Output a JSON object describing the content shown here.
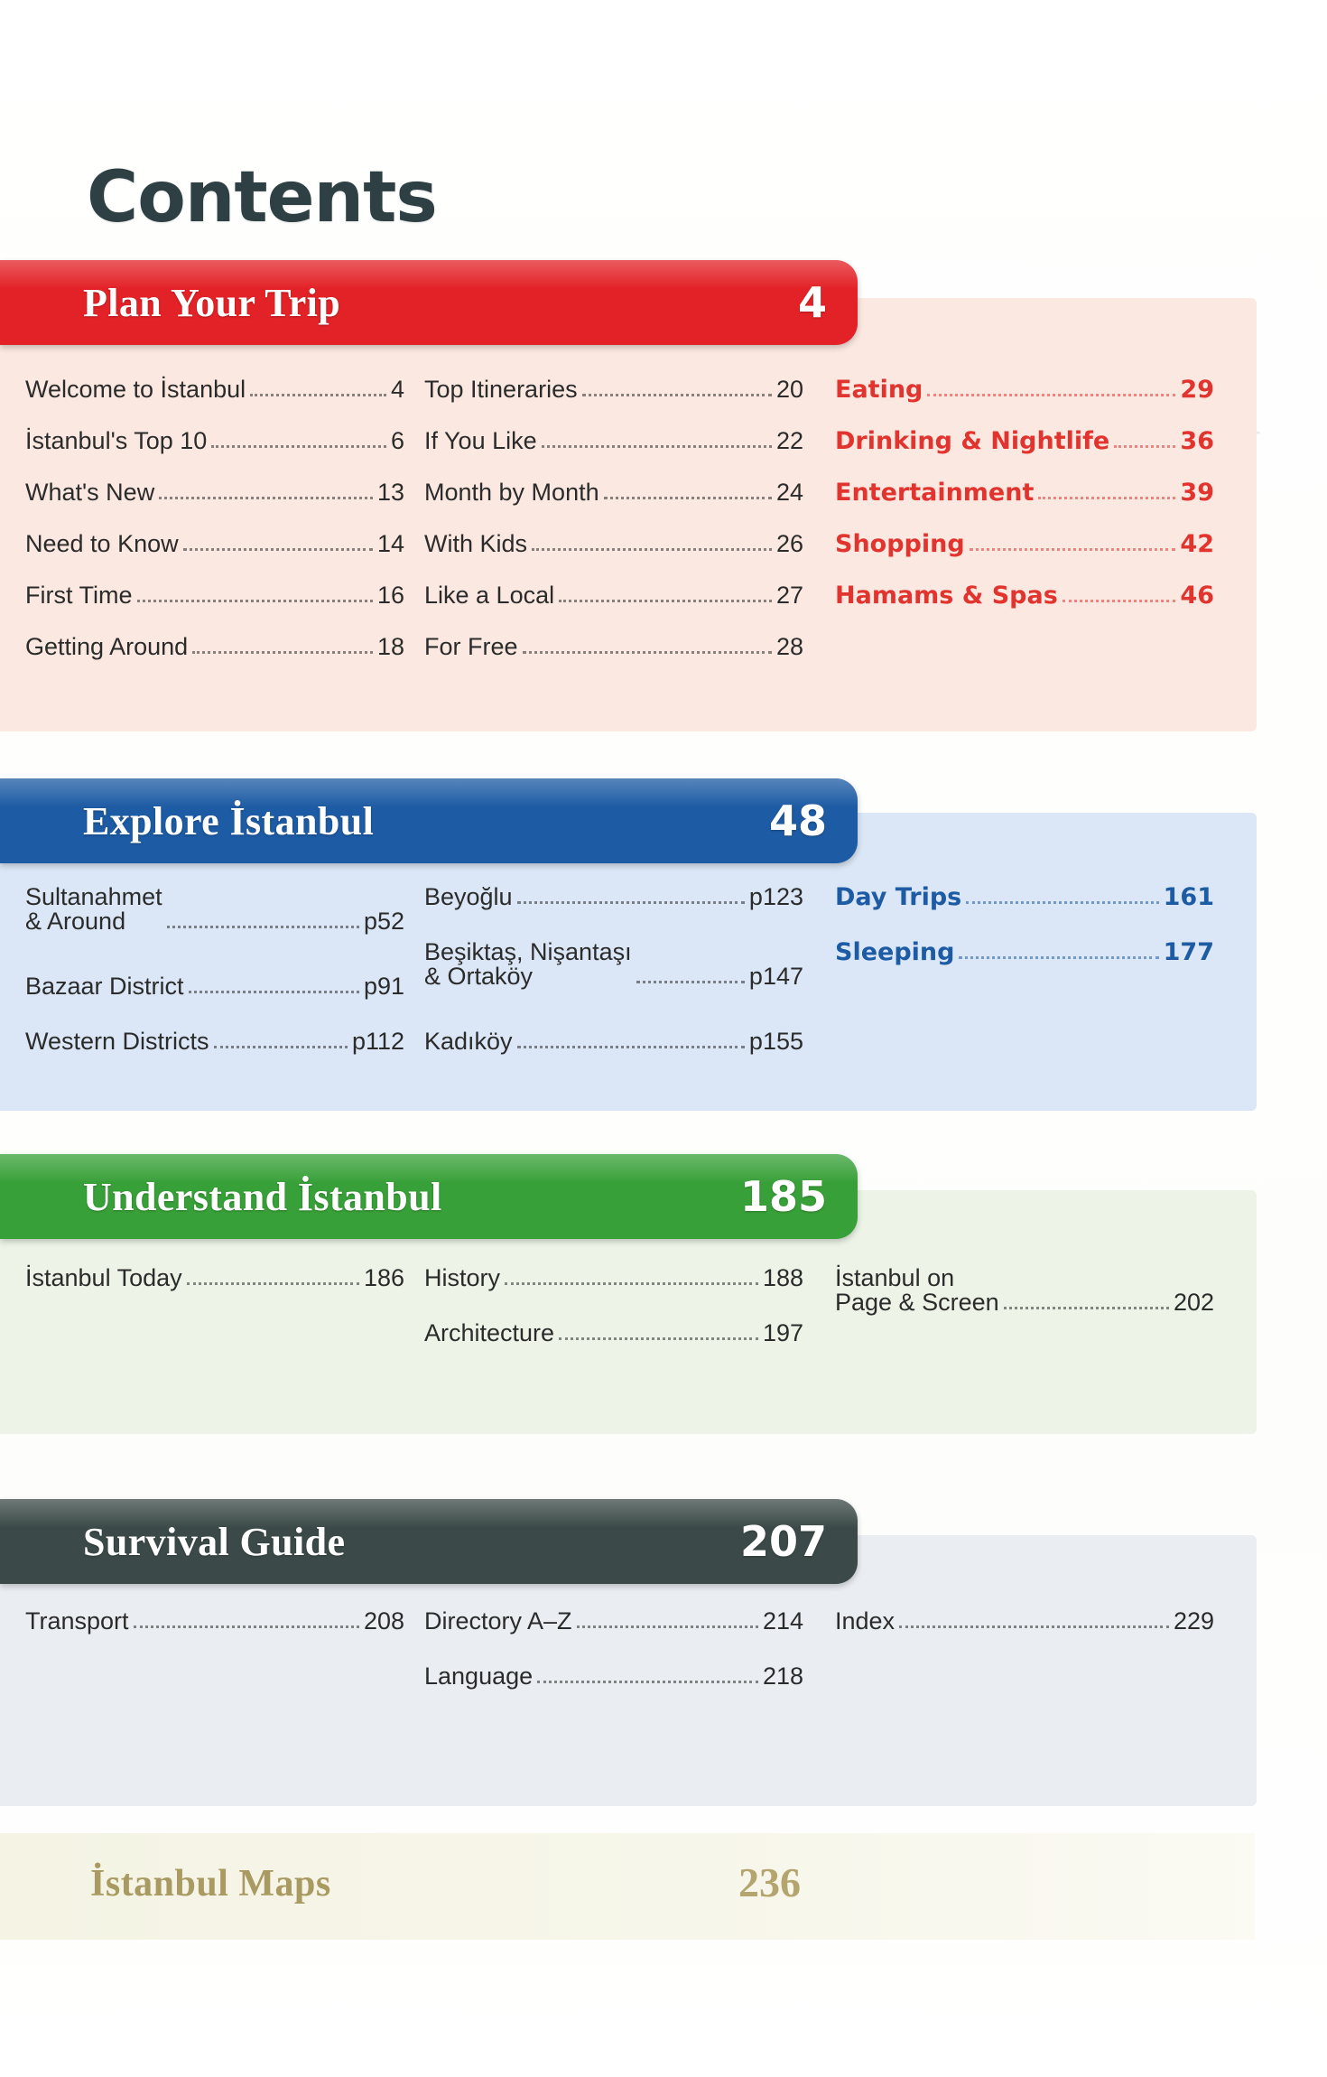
{
  "page": {
    "heading": "Contents"
  },
  "colors": {
    "plan_bar": "#e32227",
    "plan_panel": "#fbe9e1",
    "plan_accent": "#e2342f",
    "explore_bar": "#1d5ba4",
    "explore_panel": "#dbe7f6",
    "explore_accent": "#1d5ba4",
    "understand_bar": "#38a038",
    "understand_panel": "#edf4e7",
    "understand_accent": "#3c3c3c",
    "survival_bar": "#3b4a48",
    "survival_panel": "#eaeef3",
    "survival_accent": "#3c3c3c",
    "maps_strip": "#f5f4e6",
    "maps_text": "#a99a62",
    "body_text": "#2b2b2b"
  },
  "sections": [
    {
      "id": "plan-your-trip",
      "title": "Plan Your Trip",
      "page": "4",
      "columns": [
        {
          "accent": false,
          "entries": [
            {
              "label": "Welcome to İstanbul",
              "page": "4"
            },
            {
              "label": "İstanbul's Top 10",
              "page": "6"
            },
            {
              "label": "What's New",
              "page": "13"
            },
            {
              "label": "Need to Know",
              "page": "14"
            },
            {
              "label": "First Time",
              "page": "16"
            },
            {
              "label": "Getting Around",
              "page": "18"
            }
          ]
        },
        {
          "accent": false,
          "entries": [
            {
              "label": "Top Itineraries",
              "page": "20"
            },
            {
              "label": "If You Like",
              "page": "22"
            },
            {
              "label": "Month by Month",
              "page": "24"
            },
            {
              "label": "With Kids",
              "page": "26"
            },
            {
              "label": "Like a Local",
              "page": "27"
            },
            {
              "label": "For Free",
              "page": "28"
            }
          ]
        },
        {
          "accent": true,
          "entries": [
            {
              "label": "Eating",
              "page": "29"
            },
            {
              "label": "Drinking & Nightlife",
              "page": "36"
            },
            {
              "label": "Entertainment",
              "page": "39"
            },
            {
              "label": "Shopping",
              "page": "42"
            },
            {
              "label": "Hamams & Spas",
              "page": "46"
            }
          ]
        }
      ]
    },
    {
      "id": "explore-istanbul",
      "title": "Explore İstanbul",
      "page": "48",
      "columns": [
        {
          "accent": false,
          "entries": [
            {
              "label": "Sultanahmet\n& Around",
              "page": "p52",
              "twoline": true
            },
            {
              "label": "Bazaar District",
              "page": "p91"
            },
            {
              "label": "Western Districts",
              "page": "p112"
            }
          ]
        },
        {
          "accent": false,
          "entries": [
            {
              "label": "Beyoğlu",
              "page": "p123"
            },
            {
              "label": "Beşiktaş, Nişantaşı\n& Ortaköy",
              "page": "p147",
              "twoline": true
            },
            {
              "label": "Kadıköy",
              "page": "p155"
            }
          ]
        },
        {
          "accent": true,
          "entries": [
            {
              "label": "Day Trips",
              "page": "161"
            },
            {
              "label": "Sleeping",
              "page": "177"
            }
          ]
        }
      ]
    },
    {
      "id": "understand-istanbul",
      "title": "Understand İstanbul",
      "page": "185",
      "columns": [
        {
          "accent": false,
          "entries": [
            {
              "label": "İstanbul Today",
              "page": "186"
            }
          ]
        },
        {
          "accent": false,
          "entries": [
            {
              "label": "History",
              "page": "188"
            },
            {
              "label": "Architecture",
              "page": "197"
            }
          ]
        },
        {
          "accent": false,
          "entries": [
            {
              "label": "İstanbul on\nPage & Screen",
              "page": "202",
              "twoline": true
            }
          ]
        }
      ]
    },
    {
      "id": "survival-guide",
      "title": "Survival Guide",
      "page": "207",
      "columns": [
        {
          "accent": false,
          "entries": [
            {
              "label": "Transport",
              "page": "208"
            }
          ]
        },
        {
          "accent": false,
          "entries": [
            {
              "label": "Directory A–Z",
              "page": "214"
            },
            {
              "label": "Language",
              "page": "218"
            }
          ]
        },
        {
          "accent": false,
          "entries": [
            {
              "label": "Index",
              "page": "229"
            }
          ]
        }
      ]
    }
  ],
  "maps": {
    "title": "İstanbul Maps",
    "page": "236"
  }
}
